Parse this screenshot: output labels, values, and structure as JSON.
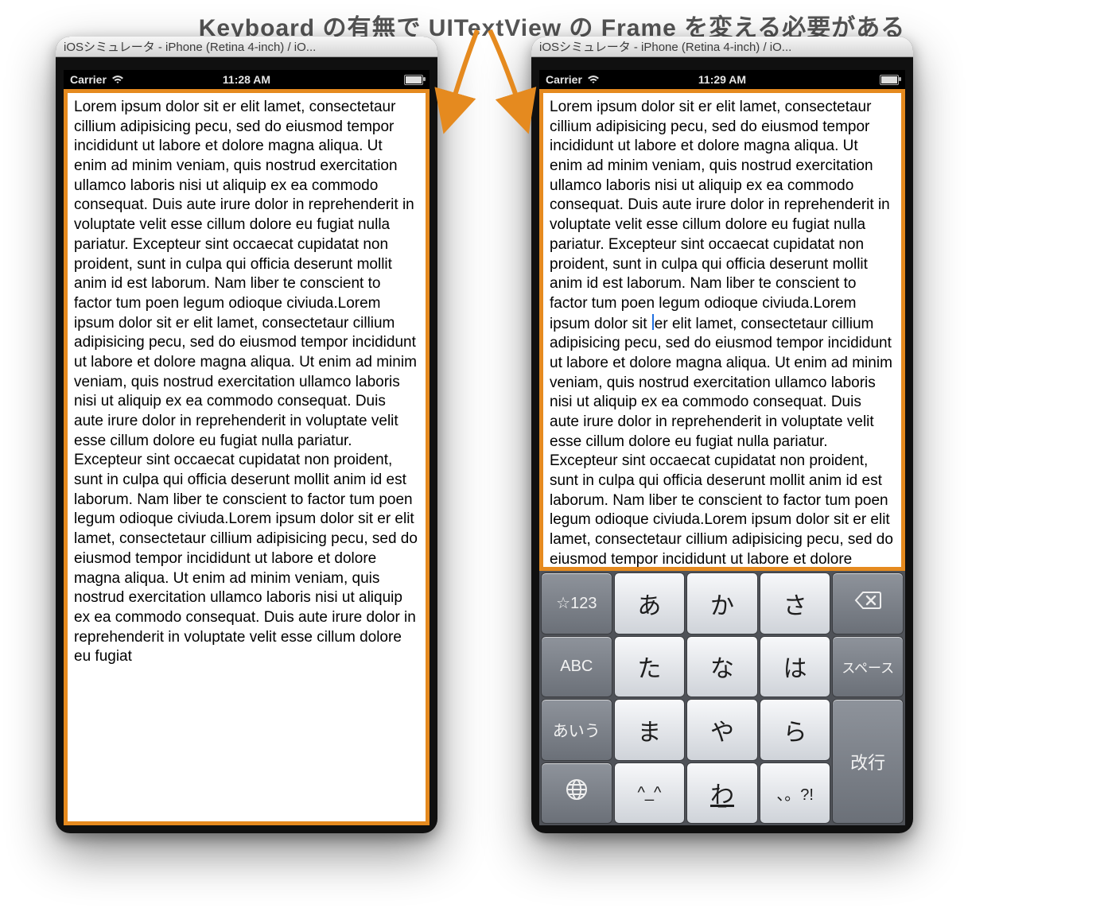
{
  "heading": "Keyboard の有無で UITextView の Frame を変える必要がある",
  "simulator_title": "iOSシミュレータ - iPhone (Retina 4-inch) / iO...",
  "status": {
    "carrier": "Carrier",
    "time_left": "11:28 AM",
    "time_right": "11:29 AM"
  },
  "text_before_caret": "Lorem ipsum dolor sit er elit lamet, consectetaur cillium adipisicing pecu, sed do eiusmod tempor incididunt ut labore et dolore magna aliqua. Ut enim ad minim veniam, quis nostrud exercitation ullamco laboris nisi ut aliquip ex ea commodo consequat. Duis aute irure dolor in reprehenderit in voluptate velit esse cillum dolore eu fugiat nulla pariatur. Excepteur sint occaecat cupidatat non proident, sunt in culpa qui officia deserunt mollit anim id est laborum. Nam liber te conscient to factor tum poen legum odioque civiuda.Lorem ipsum dolor sit ",
  "text_after_caret": "er elit lamet, consectetaur cillium adipisicing pecu, sed do eiusmod tempor incididunt ut labore et dolore magna aliqua. Ut enim ad minim veniam, quis nostrud exercitation ullamco laboris nisi ut aliquip ex ea commodo consequat. Duis aute irure dolor in reprehenderit in voluptate velit esse cillum dolore eu fugiat nulla pariatur. Excepteur sint occaecat cupidatat non proident, sunt in culpa qui officia deserunt mollit anim id est laborum. Nam liber te conscient to factor tum poen legum odioque civiuda.Lorem ipsum dolor sit er elit lamet, consectetaur cillium adipisicing pecu, sed do eiusmod tempor incididunt ut labore et dolore magna aliqua. Ut enim ad minim veniam, quis nostrud exercitation ullamco laboris nisi ut aliquip ex ea commodo consequat. Duis aute irure dolor in reprehenderit in voluptate velit esse cillum dolore eu fugiat",
  "keyboard": {
    "row1": {
      "c0": "☆123",
      "c1": "あ",
      "c2": "か",
      "c3": "さ"
    },
    "row2": {
      "c0": "ABC",
      "c1": "た",
      "c2": "な",
      "c3": "は",
      "c4": "スペース"
    },
    "row3": {
      "c0": "あいう",
      "c1": "ま",
      "c2": "や",
      "c3": "ら"
    },
    "row4": {
      "c1": "^_^",
      "c2": "わ",
      "c2sub": "ー",
      "c3": "、。?!"
    },
    "enter": "改行"
  },
  "icons": {
    "wifi": "wifi-icon",
    "battery": "battery-icon",
    "globe": "globe-icon",
    "backspace": "backspace-icon"
  },
  "colors": {
    "accent": "#e58a1f",
    "arrow": "#e58a1f"
  }
}
